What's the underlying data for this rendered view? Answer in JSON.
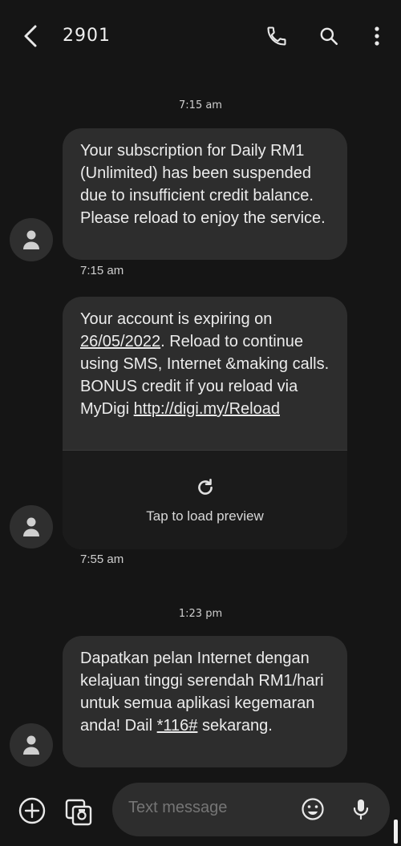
{
  "header": {
    "title": "2901"
  },
  "conversation": {
    "day_stamp_1": "7:15 am",
    "day_stamp_2": "1:23 pm",
    "messages": [
      {
        "text": "Your subscription for Daily RM1 (Unlimited) has been suspended due to insufficient credit balance. Please reload to enjoy the service.",
        "time": "7:15 am"
      },
      {
        "text_part1": "Your account is expiring on ",
        "date_link": "26/05/2022",
        "text_part2": ". Reload to continue using SMS, Internet &making calls. BONUS credit if you reload via MyDigi ",
        "url_link": "http://digi.my/Reload",
        "preview_label": "Tap to load preview",
        "time": "7:55 am"
      },
      {
        "text_part1": "Dapatkan pelan Internet dengan kelajuan tinggi serendah RM1/hari untuk semua aplikasi kegemaran anda! Dail ",
        "code_link": "*116#",
        "text_part2": " sekarang."
      }
    ]
  },
  "composer": {
    "placeholder": "Text message"
  },
  "icons": {
    "back": "back-arrow-icon",
    "call": "phone-icon",
    "search": "search-icon",
    "more": "more-vertical-icon",
    "avatar": "person-icon",
    "reload": "refresh-icon",
    "add": "add-circle-icon",
    "gallery": "gallery-icon",
    "emoji": "emoji-icon",
    "mic": "mic-icon"
  }
}
